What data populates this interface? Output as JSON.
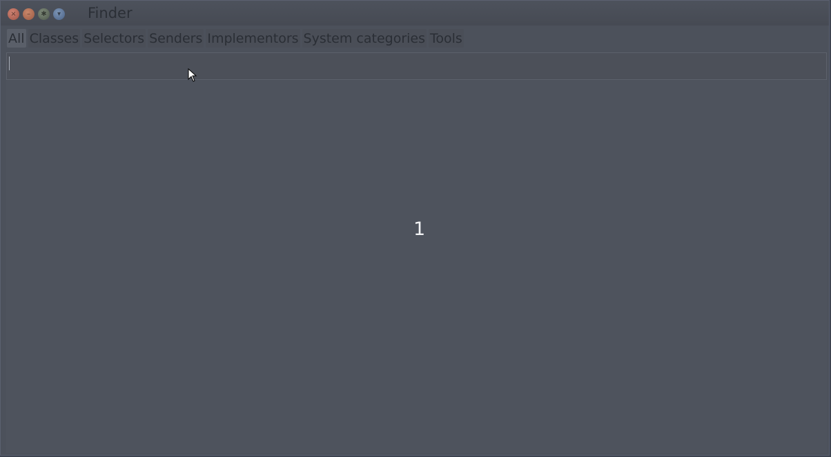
{
  "window": {
    "title": "Finder",
    "controls": {
      "close_icon": "close-icon",
      "minimize_icon": "minimize-icon",
      "menu_icon": "window-menu-icon",
      "expand_icon": "expand-icon"
    }
  },
  "tabs": [
    {
      "label": "All",
      "active": true
    },
    {
      "label": "Classes",
      "active": false
    },
    {
      "label": "Selectors",
      "active": false
    },
    {
      "label": "Senders",
      "active": false
    },
    {
      "label": "Implementors",
      "active": false
    },
    {
      "label": "System categories",
      "active": false
    },
    {
      "label": "Tools",
      "active": false
    }
  ],
  "search": {
    "value": ""
  },
  "results": {
    "count_text": "1"
  },
  "colors": {
    "background": "#4c515b",
    "text_dark": "#2a2e35",
    "count_text": "#f2f3f5"
  }
}
